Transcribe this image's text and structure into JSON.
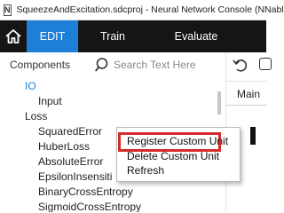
{
  "window": {
    "icon_letter": "N",
    "title": "SqueezeAndExcitation.sdcproj - Neural Network Console (NNabla)"
  },
  "menubar": {
    "tabs": [
      {
        "label": "EDIT",
        "active": true
      },
      {
        "label": "Train",
        "active": false
      },
      {
        "label": "Evaluate",
        "active": false
      }
    ],
    "active_color": "#1e7fd6",
    "background_color": "#151515"
  },
  "components_panel": {
    "title": "Components",
    "search_placeholder": "Search Text Here",
    "tree": [
      {
        "label": "IO",
        "type": "category"
      },
      {
        "label": "Input",
        "type": "item"
      },
      {
        "label": "Loss",
        "type": "category"
      },
      {
        "label": "SquaredError",
        "type": "item"
      },
      {
        "label": "HuberLoss",
        "type": "item"
      },
      {
        "label": "AbsoluteError",
        "type": "item"
      },
      {
        "label": "EpsilonInsensiti",
        "type": "item"
      },
      {
        "label": "BinaryCrossEntropy",
        "type": "item"
      },
      {
        "label": "SigmoidCrossEntropy",
        "type": "item"
      }
    ]
  },
  "editor": {
    "tab_label": "Main"
  },
  "context_menu": {
    "items": [
      {
        "label": "Register Custom Unit",
        "highlighted": true
      },
      {
        "label": "Delete Custom Unit",
        "highlighted": false
      },
      {
        "label": "Refresh",
        "highlighted": false
      }
    ],
    "highlight_color": "#d42a2a"
  }
}
